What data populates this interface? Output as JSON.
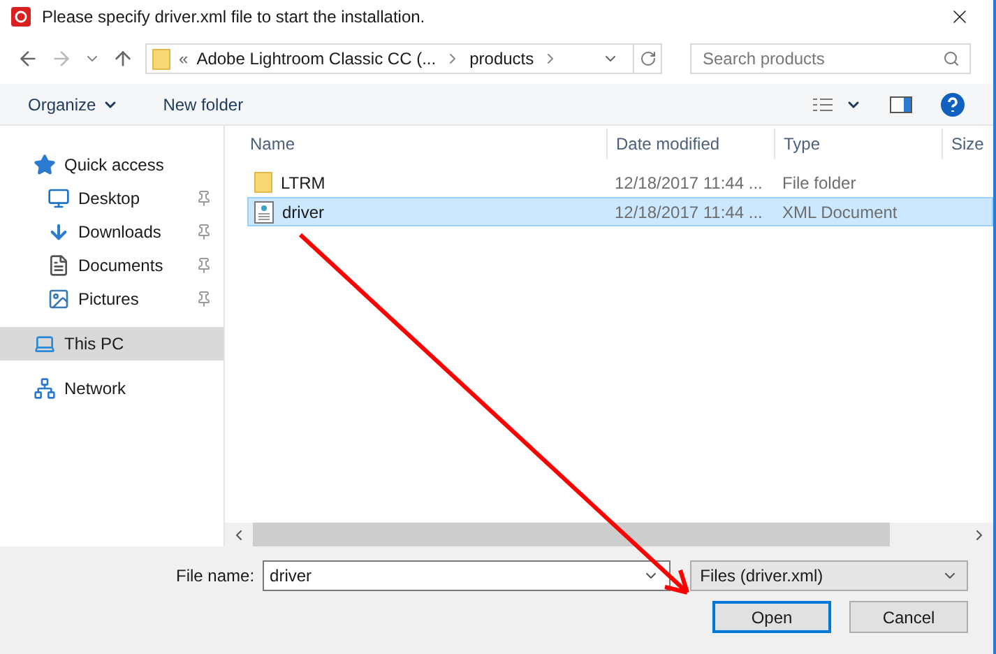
{
  "window": {
    "title": "Please specify driver.xml file to start the installation."
  },
  "address": {
    "prefix": "«",
    "segments": [
      "Adobe Lightroom Classic CC (...",
      "products"
    ]
  },
  "search": {
    "placeholder": "Search products"
  },
  "toolbar": {
    "organize": "Organize",
    "new_folder": "New folder"
  },
  "sidebar": {
    "items": [
      {
        "kind": "star",
        "label": "Quick access",
        "pinned": false,
        "selected": false,
        "children": [
          {
            "kind": "desktop",
            "label": "Desktop",
            "pinned": true,
            "selected": false
          },
          {
            "kind": "download",
            "label": "Downloads",
            "pinned": true,
            "selected": false
          },
          {
            "kind": "document",
            "label": "Documents",
            "pinned": true,
            "selected": false
          },
          {
            "kind": "picture",
            "label": "Pictures",
            "pinned": true,
            "selected": false
          }
        ]
      },
      {
        "kind": "pc",
        "label": "This PC",
        "pinned": false,
        "selected": true
      },
      {
        "kind": "network",
        "label": "Network",
        "pinned": false,
        "selected": false
      }
    ]
  },
  "table": {
    "columns": [
      "Name",
      "Date modified",
      "Type",
      "Size"
    ],
    "rows": [
      {
        "kind": "folder",
        "name": "LTRM",
        "date": "12/18/2017 11:44 ...",
        "type": "File folder",
        "selected": false
      },
      {
        "kind": "xml",
        "name": "driver",
        "date": "12/18/2017 11:44 ...",
        "type": "XML Document",
        "selected": true
      }
    ]
  },
  "file_name": {
    "label": "File name:",
    "value": "driver"
  },
  "file_type": {
    "value": "Files (driver.xml)"
  },
  "buttons": [
    {
      "label": "Open",
      "default": true
    },
    {
      "label": "Cancel",
      "default": false
    }
  ]
}
